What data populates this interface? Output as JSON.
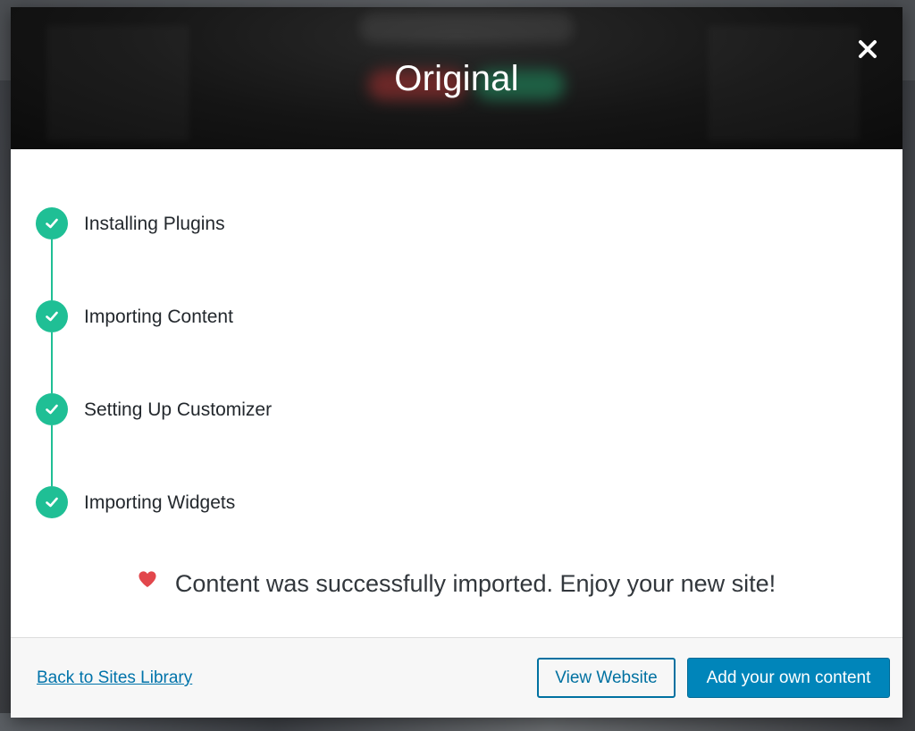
{
  "modal": {
    "title": "Original",
    "close_icon": "close-icon"
  },
  "steps": [
    {
      "label": "Installing Plugins",
      "status": "complete"
    },
    {
      "label": "Importing Content",
      "status": "complete"
    },
    {
      "label": "Setting Up Customizer",
      "status": "complete"
    },
    {
      "label": "Importing Widgets",
      "status": "complete"
    }
  ],
  "success": {
    "icon": "heart-icon",
    "message": "Content was successfully imported. Enjoy your new site!"
  },
  "footer": {
    "back_link": "Back to Sites Library",
    "view_website": "View Website",
    "add_content": "Add your own content"
  },
  "colors": {
    "accent_green": "#1fbf95",
    "primary_blue": "#0085ba",
    "link_blue": "#0073aa",
    "heart_red": "#e2474c"
  }
}
